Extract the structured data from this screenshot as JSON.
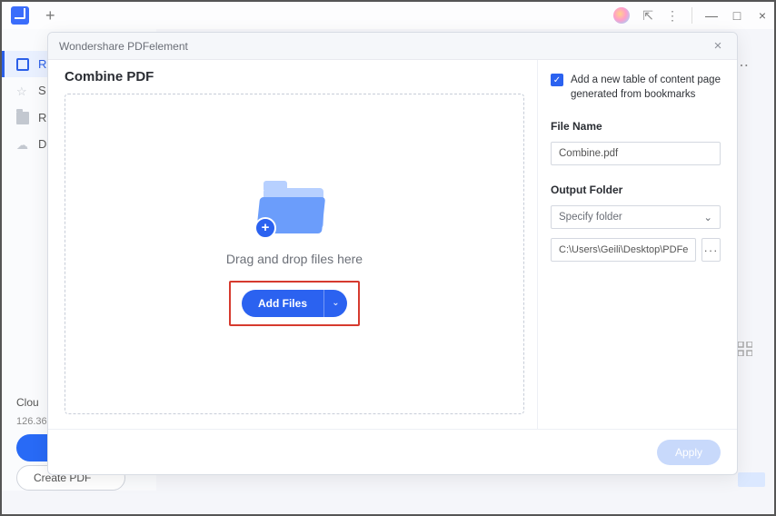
{
  "titlebar": {
    "plus": "+",
    "minimize": "—",
    "maximize": "□",
    "close": "×",
    "share": "⇱",
    "more": "⋮"
  },
  "sidebar": {
    "items": [
      {
        "label": "R"
      },
      {
        "label": "S"
      },
      {
        "label": "R"
      },
      {
        "label": "D"
      }
    ],
    "cloud_label": "Clou",
    "cloud_size": "126.36",
    "create_pdf": "Create PDF"
  },
  "overflow": "⋯",
  "dialog": {
    "title": "Wondershare PDFelement",
    "close": "×",
    "heading": "Combine PDF",
    "drop_text": "Drag and drop files here",
    "add_files": "Add Files",
    "caret": "⌄",
    "checkbox_label": "Add a new table of content page generated from bookmarks",
    "file_name_label": "File Name",
    "file_name_value": "Combine.pdf",
    "output_folder_label": "Output Folder",
    "specify_folder": "Specify folder",
    "select_caret": "⌄",
    "path_value": "C:\\Users\\Geili\\Desktop\\PDFelement\\Cc",
    "browse": "···",
    "apply": "Apply",
    "check": "✓",
    "plus_badge": "+"
  }
}
